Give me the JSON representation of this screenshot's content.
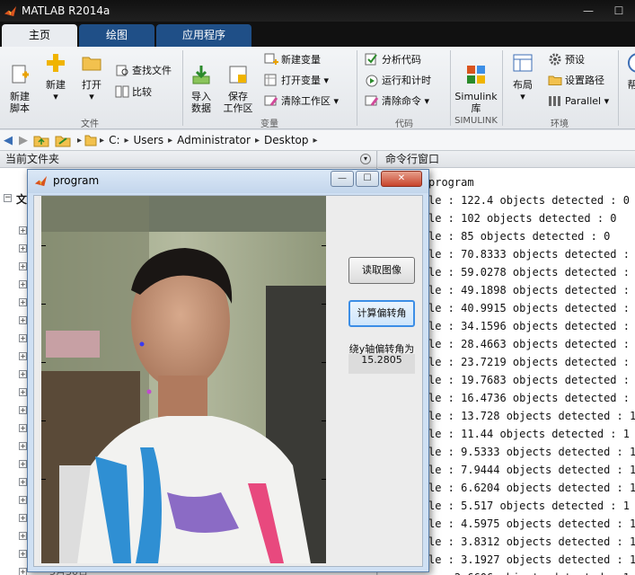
{
  "app": {
    "title": "MATLAB R2014a"
  },
  "tabs": [
    {
      "label": "主页"
    },
    {
      "label": "绘图"
    },
    {
      "label": "应用程序"
    }
  ],
  "ribbon": {
    "new_script": "新建\n脚本",
    "new": "新建",
    "open": "打开",
    "find_files": "查找文件",
    "compare": "比较",
    "import_data": "导入\n数据",
    "save_workspace": "保存\n工作区",
    "new_variable": "新建变量",
    "open_variable": "打开变量",
    "clear_workspace": "清除工作区",
    "analyze_code": "分析代码",
    "run_and_time": "运行和计时",
    "clear_commands": "清除命令",
    "simulink_library": "Simulink\n库",
    "layout": "布局",
    "preferences": "预设",
    "set_path": "设置路径",
    "parallel": "Parallel",
    "help_partial": "帮",
    "groups": {
      "file": "文件",
      "variable": "变量",
      "code": "代码",
      "simulink": "SIMULINK",
      "environment": "环境"
    }
  },
  "address": {
    "crumbs": [
      "C:",
      "Users",
      "Administrator",
      "Desktop"
    ]
  },
  "left_panel": {
    "title": "当前文件夹",
    "root_label": "文",
    "footer": "5月30日"
  },
  "command_window": {
    "title": "命令行窗口",
    "lines": [
      "program",
      "le : 122.4 objects detected : 0",
      "le : 102 objects detected : 0",
      "le : 85 objects detected : 0",
      "le : 70.8333 objects detected : 0",
      "le : 59.0278 objects detected : 0",
      "le : 49.1898 objects detected : 0",
      "le : 40.9915 objects detected : 1",
      "le : 34.1596 objects detected : 1",
      "le : 28.4663 objects detected : 1",
      "le : 23.7219 objects detected : 1",
      "le : 19.7683 objects detected : 1",
      "le : 16.4736 objects detected : 1",
      "le : 13.728 objects detected : 1",
      "le : 11.44 objects detected : 1",
      "le : 9.5333 objects detected : 1",
      "le : 7.9444 objects detected : 1",
      "le : 6.6204 objects detected : 1",
      "le : 5.517 objects detected : 1",
      "le : 4.5975 objects detected : 1",
      "le : 3.8312 objects detected : 1",
      "le : 3.1927 objects detected : 1",
      "e : 2.6606 objects detected : 1"
    ]
  },
  "program_window": {
    "title": "program",
    "read_image_button": "读取图像",
    "compute_button": "计算偏转角",
    "angle_label": "绕y轴偏转角为",
    "angle_value": "15.2805"
  }
}
